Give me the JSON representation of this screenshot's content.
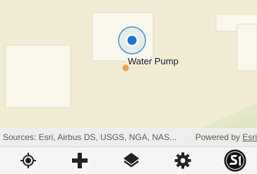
{
  "map": {
    "feature_label": "Water Pump"
  },
  "attribution": {
    "sources_text": "Sources: Esri, Airbus DS, USGS, NGA, NAS...",
    "powered_prefix": "Powered by ",
    "powered_link": "Esri"
  },
  "toolbar": {
    "buttons": [
      {
        "icon": "my-location-icon"
      },
      {
        "icon": "add-icon"
      },
      {
        "icon": "layers-icon"
      },
      {
        "icon": "settings-icon"
      },
      {
        "icon": "app-logo-icon",
        "label": "S1"
      }
    ]
  },
  "colors": {
    "map_background": "#f3efd8",
    "building": "#f9f6ea",
    "marker_blue": "#1976d2",
    "feature_orange": "#f29c5b",
    "toolbar_background": "#f5f5f5"
  }
}
